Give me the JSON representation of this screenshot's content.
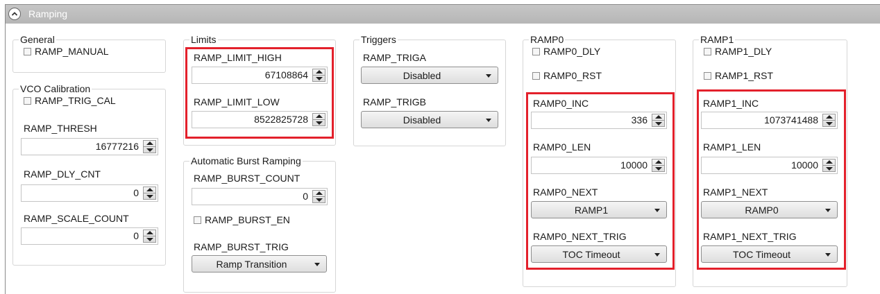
{
  "panel": {
    "title": "Ramping"
  },
  "general": {
    "legend": "General",
    "ramp_manual": "RAMP_MANUAL"
  },
  "vco": {
    "legend": "VCO Calibration",
    "ramp_trig_cal": "RAMP_TRIG_CAL",
    "ramp_thresh_label": "RAMP_THRESH",
    "ramp_thresh_value": "16777216",
    "ramp_dly_cnt_label": "RAMP_DLY_CNT",
    "ramp_dly_cnt_value": "0",
    "ramp_scale_count_label": "RAMP_SCALE_COUNT",
    "ramp_scale_count_value": "0"
  },
  "limits": {
    "legend": "Limits",
    "high_label": "RAMP_LIMIT_HIGH",
    "high_value": "67108864",
    "low_label": "RAMP_LIMIT_LOW",
    "low_value": "8522825728"
  },
  "burst": {
    "legend": "Automatic Burst Ramping",
    "count_label": "RAMP_BURST_COUNT",
    "count_value": "0",
    "en_label": "RAMP_BURST_EN",
    "trig_label": "RAMP_BURST_TRIG",
    "trig_value": "Ramp Transition"
  },
  "triggers": {
    "legend": "Triggers",
    "triga_label": "RAMP_TRIGA",
    "triga_value": "Disabled",
    "trigb_label": "RAMP_TRIGB",
    "trigb_value": "Disabled"
  },
  "ramp0": {
    "legend": "RAMP0",
    "dly": "RAMP0_DLY",
    "rst": "RAMP0_RST",
    "inc_label": "RAMP0_INC",
    "inc_value": "336",
    "len_label": "RAMP0_LEN",
    "len_value": "10000",
    "next_label": "RAMP0_NEXT",
    "next_value": "RAMP1",
    "next_trig_label": "RAMP0_NEXT_TRIG",
    "next_trig_value": "TOC Timeout"
  },
  "ramp1": {
    "legend": "RAMP1",
    "dly": "RAMP1_DLY",
    "rst": "RAMP1_RST",
    "inc_label": "RAMP1_INC",
    "inc_value": "1073741488",
    "len_label": "RAMP1_LEN",
    "len_value": "10000",
    "next_label": "RAMP1_NEXT",
    "next_value": "RAMP0",
    "next_trig_label": "RAMP1_NEXT_TRIG",
    "next_trig_value": "TOC Timeout"
  },
  "colors": {
    "highlight": "#e3202b",
    "header": "#bdbdbd"
  }
}
